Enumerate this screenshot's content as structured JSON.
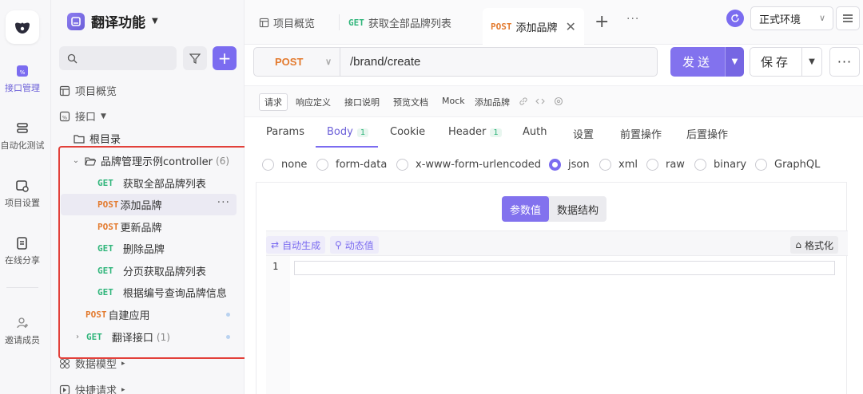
{
  "app": {
    "name": "翻译功能"
  },
  "rail": {
    "items": [
      {
        "label": "接口管理",
        "icon": "api-manage-icon"
      },
      {
        "label": "自动化测试",
        "icon": "auto-test-icon"
      },
      {
        "label": "项目设置",
        "icon": "project-settings-icon"
      },
      {
        "label": "在线分享",
        "icon": "share-icon"
      },
      {
        "label": "邀请成员",
        "icon": "invite-member-icon"
      }
    ]
  },
  "sidebar": {
    "search_placeholder": "",
    "overview": "项目概览",
    "interfaces": "接口",
    "root": "根目录",
    "folder": {
      "name": "品牌管理示例controller",
      "count": "(6)"
    },
    "items": [
      {
        "method": "GET",
        "name": "获取全部品牌列表"
      },
      {
        "method": "POST",
        "name": "添加品牌",
        "more": "···"
      },
      {
        "method": "POST",
        "name": "更新品牌"
      },
      {
        "method": "GET",
        "name": "删除品牌"
      },
      {
        "method": "GET",
        "name": "分页获取品牌列表"
      },
      {
        "method": "GET",
        "name": "根据编号查询品牌信息"
      }
    ],
    "custom_app": {
      "method": "POST",
      "name": "自建应用"
    },
    "translate": {
      "method": "GET",
      "name": "翻译接口",
      "count": "(1)"
    },
    "data_model": "数据模型",
    "quick_request": "快捷请求"
  },
  "tabs": {
    "items": [
      {
        "method": "",
        "label": "项目概览"
      },
      {
        "method": "GET",
        "label": "获取全部品牌列表"
      },
      {
        "method": "POST",
        "label": "添加品牌"
      }
    ],
    "plus": "+",
    "more": "···",
    "env": "正式环境"
  },
  "request": {
    "method": "POST",
    "url": "/brand/create",
    "send": "发送",
    "save": "保存",
    "more": "···"
  },
  "subtabs": [
    "请求",
    "响应定义",
    "接口说明",
    "预览文档",
    "Mock",
    "添加品牌"
  ],
  "param_tabs": [
    {
      "label": "Params",
      "badge": ""
    },
    {
      "label": "Body",
      "badge": "1"
    },
    {
      "label": "Cookie",
      "badge": ""
    },
    {
      "label": "Header",
      "badge": "1"
    },
    {
      "label": "Auth",
      "badge": ""
    },
    {
      "label": "设置",
      "badge": ""
    },
    {
      "label": "前置操作",
      "badge": ""
    },
    {
      "label": "后置操作",
      "badge": ""
    }
  ],
  "body_types": [
    "none",
    "form-data",
    "x-www-form-urlencoded",
    "json",
    "xml",
    "raw",
    "binary",
    "GraphQL"
  ],
  "body_selected": "json",
  "editor": {
    "seg_values": "参数值",
    "seg_structure": "数据结构",
    "auto_generate": "自动生成",
    "dynamic_value": "动态值",
    "format": "格式化",
    "line1": "1"
  },
  "colors": {
    "accent": "#7b6cf0",
    "get": "#2fb57a",
    "post": "#e37a2e",
    "highlight_box": "#e2403a"
  }
}
